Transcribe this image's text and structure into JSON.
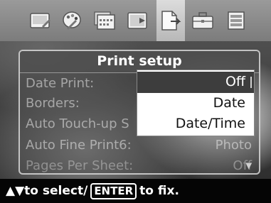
{
  "icon_bar": {
    "tabs": [
      {
        "icon": "image-edit-icon"
      },
      {
        "icon": "palette-icon"
      },
      {
        "icon": "calendar-icon"
      },
      {
        "icon": "slideshow-icon"
      },
      {
        "icon": "print-setup-icon",
        "active": true
      },
      {
        "icon": "toolbox-icon"
      },
      {
        "icon": "settings-icon"
      }
    ]
  },
  "panel": {
    "title": "Print setup",
    "rows": [
      {
        "label": "Date Print:",
        "value": ""
      },
      {
        "label": "Borders:",
        "value": ""
      },
      {
        "label": "Auto Touch-up S",
        "value": ""
      },
      {
        "label": "Auto Fine Print6:",
        "value": "Photo"
      },
      {
        "label": "Pages Per Sheet:",
        "value": "Off"
      }
    ]
  },
  "dropdown": {
    "options": [
      "Off",
      "Date",
      "Date/Time"
    ],
    "selected": "Off"
  },
  "footer": {
    "arrows": "▲▼",
    "text1": "to select/",
    "enter": "ENTER",
    "text2": "to fix."
  }
}
